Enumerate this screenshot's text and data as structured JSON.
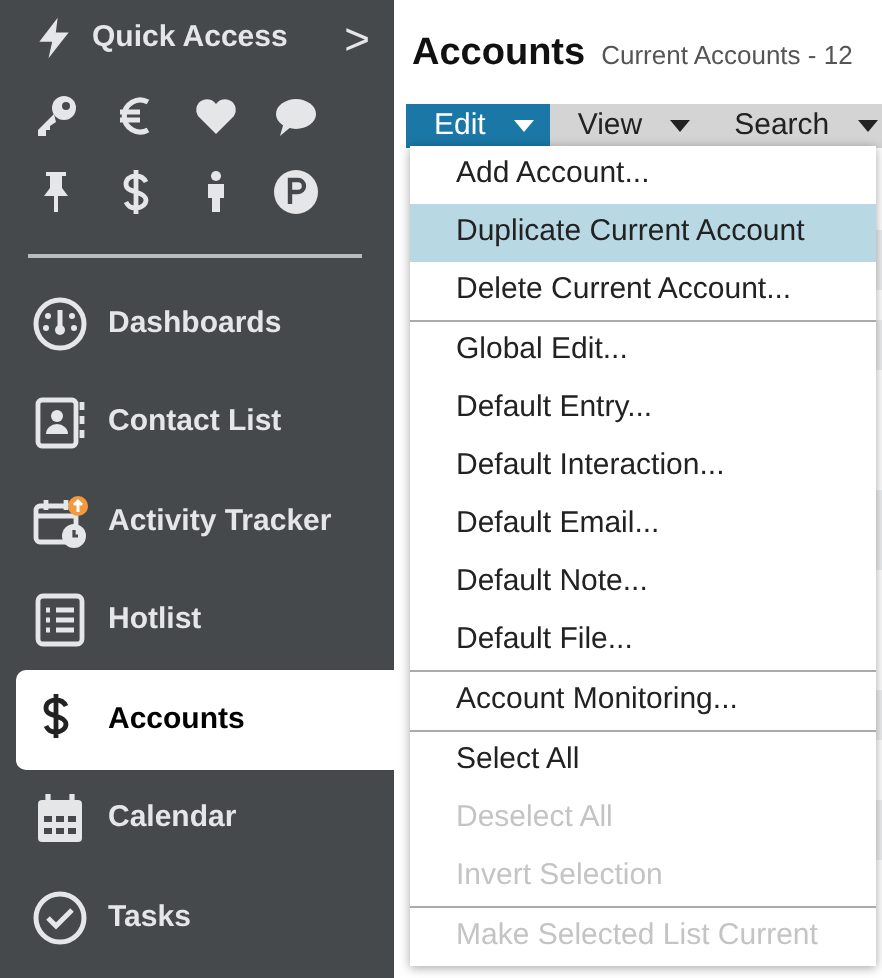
{
  "sidebar": {
    "quick_access": {
      "label": "Quick Access",
      "arrow": ">"
    },
    "shortcuts": [
      {
        "kind": "key"
      },
      {
        "kind": "euro"
      },
      {
        "kind": "heart"
      },
      {
        "kind": "chat"
      },
      {
        "kind": "pin"
      },
      {
        "kind": "dollar"
      },
      {
        "kind": "person"
      },
      {
        "kind": "parking"
      }
    ],
    "items": [
      {
        "label": "Dashboards",
        "kind": "gauge",
        "selected": false
      },
      {
        "label": "Contact List",
        "kind": "contact",
        "selected": false
      },
      {
        "label": "Activity Tracker",
        "kind": "activity",
        "selected": false
      },
      {
        "label": "Hotlist",
        "kind": "list",
        "selected": false
      },
      {
        "label": "Accounts",
        "kind": "dollar",
        "selected": true
      },
      {
        "label": "Calendar",
        "kind": "calendar",
        "selected": false
      },
      {
        "label": "Tasks",
        "kind": "check",
        "selected": false
      }
    ]
  },
  "header": {
    "title": "Accounts",
    "subtitle": "Current Accounts - 12"
  },
  "menubar": [
    {
      "label": "Edit",
      "selected": true
    },
    {
      "label": "View",
      "selected": false
    },
    {
      "label": "Search",
      "selected": false
    }
  ],
  "dropdown": {
    "groups": [
      [
        {
          "label": "Add Account...",
          "selected": false,
          "disabled": false
        },
        {
          "label": "Duplicate Current Account",
          "selected": true,
          "disabled": false
        },
        {
          "label": "Delete Current Account...",
          "selected": false,
          "disabled": false
        }
      ],
      [
        {
          "label": "Global Edit...",
          "selected": false,
          "disabled": false
        },
        {
          "label": "Default Entry...",
          "selected": false,
          "disabled": false
        },
        {
          "label": "Default Interaction...",
          "selected": false,
          "disabled": false
        },
        {
          "label": "Default Email...",
          "selected": false,
          "disabled": false
        },
        {
          "label": "Default Note...",
          "selected": false,
          "disabled": false
        },
        {
          "label": "Default File...",
          "selected": false,
          "disabled": false
        }
      ],
      [
        {
          "label": "Account Monitoring...",
          "selected": false,
          "disabled": false
        }
      ],
      [
        {
          "label": "Select All",
          "selected": false,
          "disabled": false
        },
        {
          "label": "Deselect All",
          "selected": false,
          "disabled": true
        },
        {
          "label": "Invert Selection",
          "selected": false,
          "disabled": true
        }
      ],
      [
        {
          "label": "Make Selected List Current",
          "selected": false,
          "disabled": true
        }
      ]
    ]
  }
}
